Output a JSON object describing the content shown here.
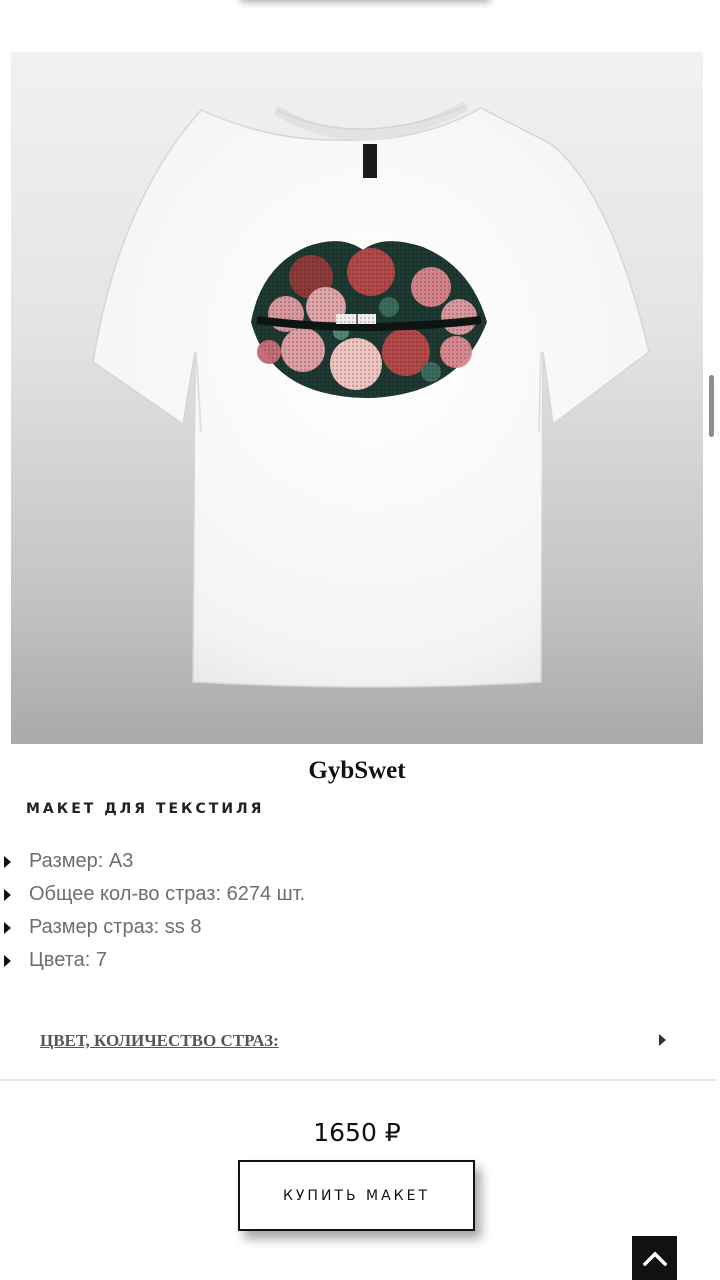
{
  "product": {
    "title": "GybSwet",
    "subtitle": "МАКЕТ ДЛЯ ТЕКСТИЛЯ",
    "image": "t-shirt-lips-rhinestone-design"
  },
  "specs": [
    {
      "text": "Размер: А3"
    },
    {
      "text": "Общее кол-во страз: 6274 шт."
    },
    {
      "text": "Размер страз: ss 8"
    },
    {
      "text": "Цвета: 7"
    }
  ],
  "accordion": {
    "label": "ЦВЕТ, КОЛИЧЕСТВО СТРАЗ:",
    "icon": "caret-right-icon"
  },
  "purchase": {
    "price": "1650 ₽",
    "button_label": "КУПИТЬ МАКЕТ"
  },
  "scroll_top": {
    "icon": "chevron-up-icon"
  },
  "colors": {
    "button_border": "#111111",
    "scroll_top_bg": "#111111",
    "spec_text": "#6e6e6e",
    "accordion_text": "#555555"
  }
}
